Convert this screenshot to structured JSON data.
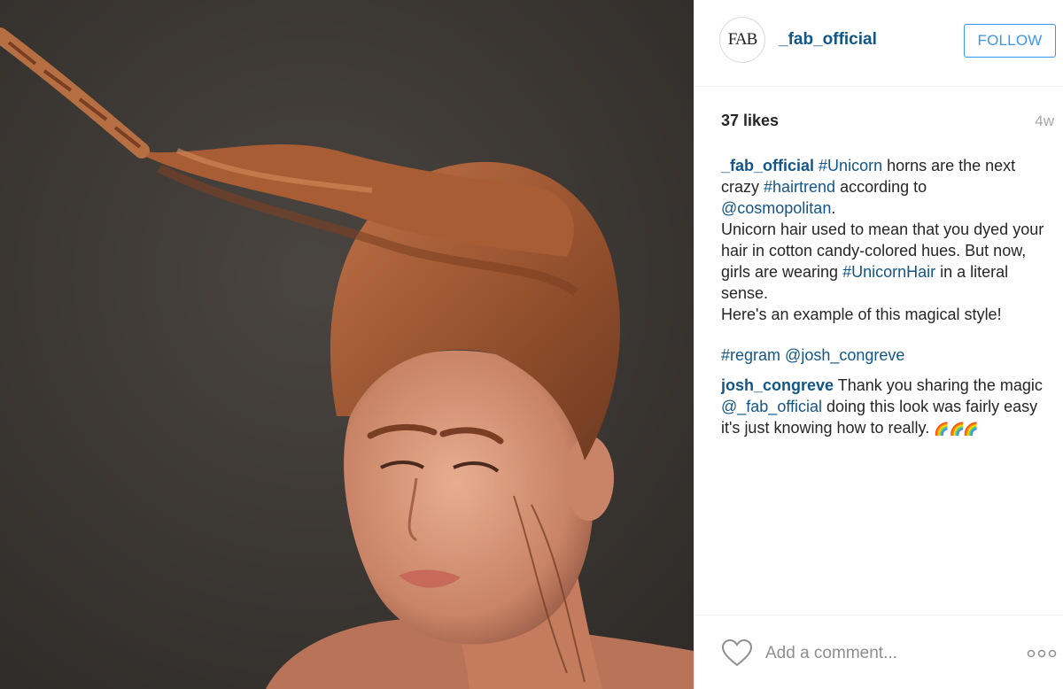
{
  "post": {
    "image_alt": "Woman with a twisted unicorn horn hairstyle",
    "header": {
      "avatar_text": "FAB",
      "username": "_fab_official",
      "follow_label": "FOLLOW"
    },
    "meta": {
      "likes": "37 likes",
      "time": "4w"
    },
    "caption": {
      "author": "_fab_official",
      "tag_unicorn": "#Unicorn",
      "text_1": " horns are the next crazy ",
      "tag_hairtrend": "#hairtrend",
      "text_2": " according to ",
      "mention_cosmo": "@cosmopolitan",
      "text_3": ".",
      "text_4": "Unicorn hair used to mean that you dyed your hair in cotton candy-colored hues. But now, girls are wearing ",
      "tag_unicornhair": "#UnicornHair",
      "text_5": " in a literal sense.",
      "text_6": "Here's an example of this magical style!"
    },
    "regram": {
      "tag": "#regram",
      "mention": "@josh_congreve"
    },
    "reply": {
      "author": "josh_congreve",
      "text_1": " Thank you sharing the magic ",
      "mention": "@_fab_official",
      "text_2": " doing this look was fairly easy it's just knowing how to really. ",
      "emoji": "🌈 🌈🌈"
    },
    "footer": {
      "comment_placeholder": "Add a comment...",
      "like_icon": "heart-icon",
      "more_icon": "more-options-icon"
    }
  },
  "colors": {
    "link": "#125688",
    "follow": "#3897f0",
    "muted": "#a5a7aa"
  }
}
